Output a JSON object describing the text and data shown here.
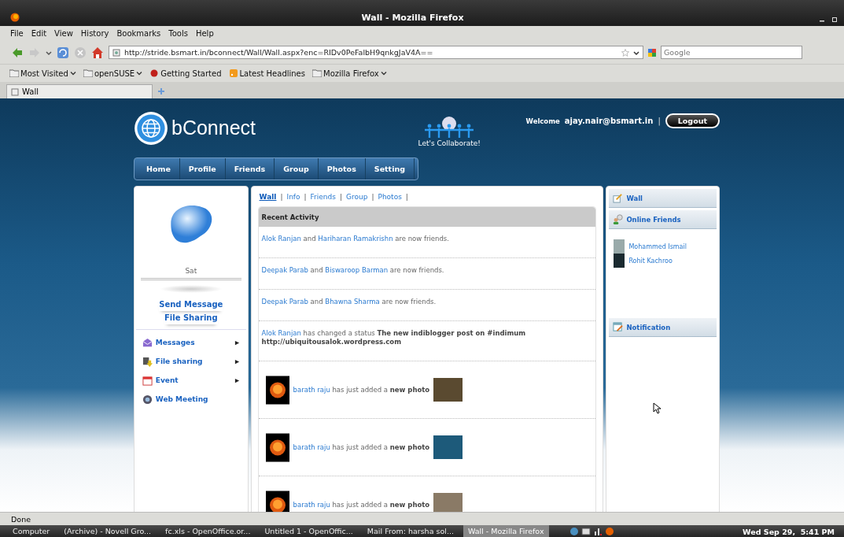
{
  "window": {
    "title": "Wall - Mozilla Firefox"
  },
  "menu": [
    "File",
    "Edit",
    "View",
    "History",
    "Bookmarks",
    "Tools",
    "Help"
  ],
  "address": "http://stride.bsmart.in/bconnect/Wall/Wall.aspx?enc=RIDv0PeFalbH9qnkgJaV4A==",
  "search": {
    "placeholder": "Google"
  },
  "bookmarks": [
    {
      "label": "Most Visited",
      "kind": "folder-menu"
    },
    {
      "label": "openSUSE",
      "kind": "folder-menu"
    },
    {
      "label": "Getting Started",
      "kind": "link"
    },
    {
      "label": "Latest Headlines",
      "kind": "feed"
    },
    {
      "label": "Mozilla Firefox",
      "kind": "folder-menu"
    }
  ],
  "tab": {
    "title": "Wall"
  },
  "site": {
    "logo": "bConnect",
    "tagline": "Let's Collaborate!",
    "welcome": "Welcome",
    "user": "ajay.nair@bsmart.in",
    "separator": "|",
    "logout": "Logout"
  },
  "nav": [
    "Home",
    "Profile",
    "Friends",
    "Group",
    "Photos",
    "Setting"
  ],
  "profile": {
    "name": "Sat",
    "actions": [
      "Send Message",
      "File Sharing"
    ],
    "menu": [
      {
        "label": "Messages",
        "kind": "messages",
        "submenu": true
      },
      {
        "label": "File sharing",
        "kind": "files",
        "submenu": true
      },
      {
        "label": "Event",
        "kind": "event",
        "submenu": true
      },
      {
        "label": "Web Meeting",
        "kind": "meeting",
        "submenu": false
      }
    ]
  },
  "wall_tabs": [
    {
      "label": "Wall",
      "selected": true
    },
    {
      "label": "Info",
      "selected": false
    },
    {
      "label": "Friends",
      "selected": false
    },
    {
      "label": "Group",
      "selected": false
    },
    {
      "label": "Photos",
      "selected": false
    }
  ],
  "wall_tab_separator": "|",
  "activity": {
    "title": "Recent Activity",
    "items": [
      {
        "kind": "friends",
        "actor": "Alok Ranjan",
        "text_1": "and",
        "target": "Hariharan Ramakrishn",
        "text_2": "are now friends."
      },
      {
        "kind": "friends",
        "actor": "Deepak Parab",
        "text_1": "and",
        "target": "Biswaroop Barman",
        "text_2": "are now friends."
      },
      {
        "kind": "friends",
        "actor": "Deepak Parab",
        "text_1": "and",
        "target": "Bhawna Sharma",
        "text_2": "are now friends."
      },
      {
        "kind": "status",
        "actor": "Alok Ranjan",
        "text_1": "has changed a status",
        "status": "The new indiblogger post on #indimum http://ubiquitousalok.wordpress.com"
      },
      {
        "kind": "photo",
        "actor": "barath raju",
        "text_1": "has just added a",
        "object": "new photo",
        "color": "#5a4a30"
      },
      {
        "kind": "photo",
        "actor": "barath raju",
        "text_1": "has just added a",
        "object": "new photo",
        "color": "#1d5a7a"
      },
      {
        "kind": "photo",
        "actor": "barath raju",
        "text_1": "has just added a",
        "object": "new photo",
        "color": "#8a7a66"
      }
    ]
  },
  "sidebar": {
    "wall": "Wall",
    "online_title": "Online Friends",
    "online": [
      "Mohammed Ismail",
      "Rohit Kachroo"
    ],
    "notification": "Notification"
  },
  "status_bar": "Done",
  "taskbar": {
    "items": [
      {
        "label": "Computer",
        "selected": false
      },
      {
        "label": "(Archive) - Novell Gro...",
        "selected": false
      },
      {
        "label": "fc.xls - OpenOffice.or...",
        "selected": false
      },
      {
        "label": "Untitled 1 - OpenOffic...",
        "selected": false
      },
      {
        "label": "Mail From: harsha sol...",
        "selected": false
      },
      {
        "label": "Wall - Mozilla Firefox",
        "selected": true
      }
    ],
    "clock": "Wed Sep 29,  5:41 PM"
  }
}
